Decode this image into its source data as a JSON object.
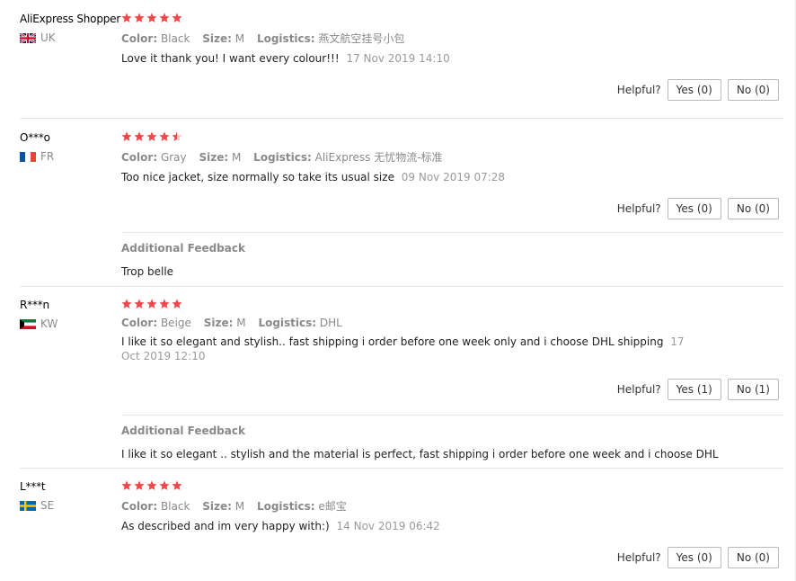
{
  "helpful_label": "Helpful?",
  "colors": {
    "star": "#f0474b",
    "accent_text": "#8a8a8a"
  },
  "reviews": [
    {
      "user": "AliExpress Shopper",
      "country": "UK",
      "flag": "uk",
      "rating": 5,
      "color_label": "Color:",
      "color": "Black",
      "size_label": "Size:",
      "size": "M",
      "logistics_label": "Logistics:",
      "logistics": "燕文航空挂号小包",
      "text": "Love it thank you! I want every colour!!!",
      "date": "17 Nov 2019 14:10",
      "yes": "Yes (0)",
      "no": "No (0)"
    },
    {
      "user": "O***o",
      "country": "FR",
      "flag": "fr",
      "rating": 4.5,
      "color_label": "Color:",
      "color": "Gray",
      "size_label": "Size:",
      "size": "M",
      "logistics_label": "Logistics:",
      "logistics": "AliExpress 无忧物流-标准",
      "text": "Too nice jacket, size normally so take its usual size",
      "date": "09 Nov 2019 07:28",
      "yes": "Yes (0)",
      "no": "No (0)",
      "additional_title": "Additional Feedback",
      "additional_text": "Trop belle"
    },
    {
      "user": "R***n",
      "country": "KW",
      "flag": "kw",
      "rating": 5,
      "color_label": "Color:",
      "color": "Beige",
      "size_label": "Size:",
      "size": "M",
      "logistics_label": "Logistics:",
      "logistics": "DHL",
      "text": "I like it so elegant and stylish.. fast shipping i order before one week only and i choose DHL shipping",
      "date": "17 Oct 2019 12:10",
      "yes": "Yes (1)",
      "no": "No (1)",
      "additional_title": "Additional Feedback",
      "additional_text": "I like it so elegant .. stylish and the material is perfect, fast shipping i order before one week and i choose DHL"
    },
    {
      "user": "L***t",
      "country": "SE",
      "flag": "se",
      "rating": 5,
      "color_label": "Color:",
      "color": "Black",
      "size_label": "Size:",
      "size": "M",
      "logistics_label": "Logistics:",
      "logistics": "e邮宝",
      "text": "As described and im very happy with:)",
      "date": "14 Nov 2019 06:42",
      "yes": "Yes (0)",
      "no": "No (0)"
    }
  ]
}
